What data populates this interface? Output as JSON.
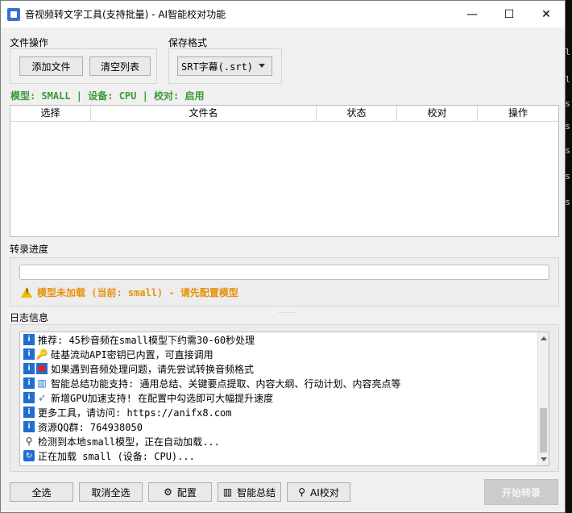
{
  "window": {
    "title": "音视频转文字工具(支持批量) - AI智能校对功能",
    "minimize": "—",
    "maximize": "☐",
    "close": "✕"
  },
  "file_ops": {
    "label": "文件操作",
    "add_files": "添加文件",
    "clear_list": "清空列表"
  },
  "save_format": {
    "label": "保存格式",
    "selected": "SRT字幕(.srt)"
  },
  "status": "模型: SMALL | 设备: CPU | 校对: 启用",
  "table": {
    "headers": [
      "选择",
      "文件名",
      "状态",
      "校对",
      "操作"
    ]
  },
  "progress": {
    "label": "转录进度",
    "value": 0,
    "warning": "模型未加载 (当前: small) - 请先配置模型"
  },
  "log": {
    "label": "日志信息",
    "items": [
      {
        "icon": "info-icon",
        "text": "推荐: 45秒音频在small模型下约需30-60秒处理"
      },
      {
        "icon": "key-icon",
        "text": "硅基流动API密钥已内置，可直接调用"
      },
      {
        "icon": "stop-icon",
        "text": "如果遇到音频处理问题，请先尝试转换音频格式"
      },
      {
        "icon": "chart-icon",
        "text": "智能总结功能支持: 通用总结、关键要点提取、内容大纲、行动计划、内容亮点等"
      },
      {
        "icon": "rocket-icon",
        "text": "新增GPU加速支持! 在配置中勾选即可大幅提升速度"
      },
      {
        "icon": "info-icon",
        "text": "更多工具，请访问: https://anifx8.com"
      },
      {
        "icon": "info-icon",
        "text": "资源QQ群: 764938050"
      },
      {
        "icon": "magnifier-icon",
        "text": "检测到本地small模型，正在自动加载..."
      },
      {
        "icon": "loading-icon",
        "text": "正在加载 small (设备: CPU)..."
      }
    ]
  },
  "bottom": {
    "select_all": "全选",
    "deselect_all": "取消全选",
    "config": "配置",
    "summary": "智能总结",
    "ai_proof": "AI校对",
    "start": "开始转录"
  },
  "colors": {
    "status_green": "#3a9a3a",
    "warning_orange": "#e8900c",
    "info_blue": "#1f6fd1"
  }
}
